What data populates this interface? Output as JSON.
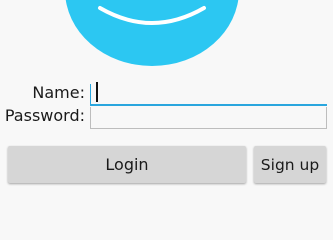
{
  "logo": {
    "icon": "smiley-face-icon",
    "color": "#2cc7f2"
  },
  "form": {
    "name_label": "Name:",
    "name_value": "",
    "password_label": "Password:",
    "password_value": ""
  },
  "buttons": {
    "login_label": "Login",
    "signup_label": "Sign up"
  },
  "colors": {
    "accent": "#2aa6de",
    "button_bg": "#d6d6d6",
    "background": "#f8f8f8"
  }
}
